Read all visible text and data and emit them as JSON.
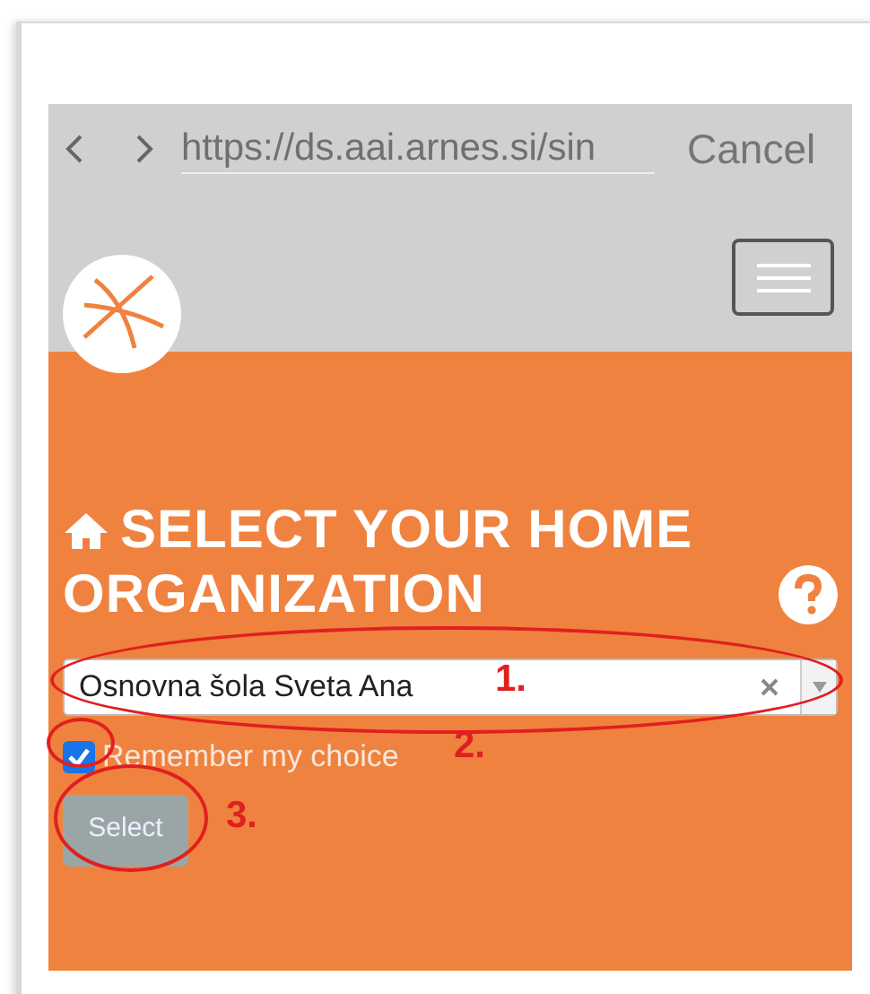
{
  "browser_bar": {
    "url": "https://ds.aai.arnes.si/sin",
    "cancel": "Cancel"
  },
  "page": {
    "title": "SELECT YOUR HOME ORGANIZATION",
    "organization": "Osnovna šola Sveta Ana",
    "remember": {
      "label": "Remember my choice",
      "checked": true
    },
    "button": "Select"
  },
  "annotations": [
    {
      "label": "1."
    },
    {
      "label": "2."
    },
    {
      "label": "3."
    }
  ]
}
